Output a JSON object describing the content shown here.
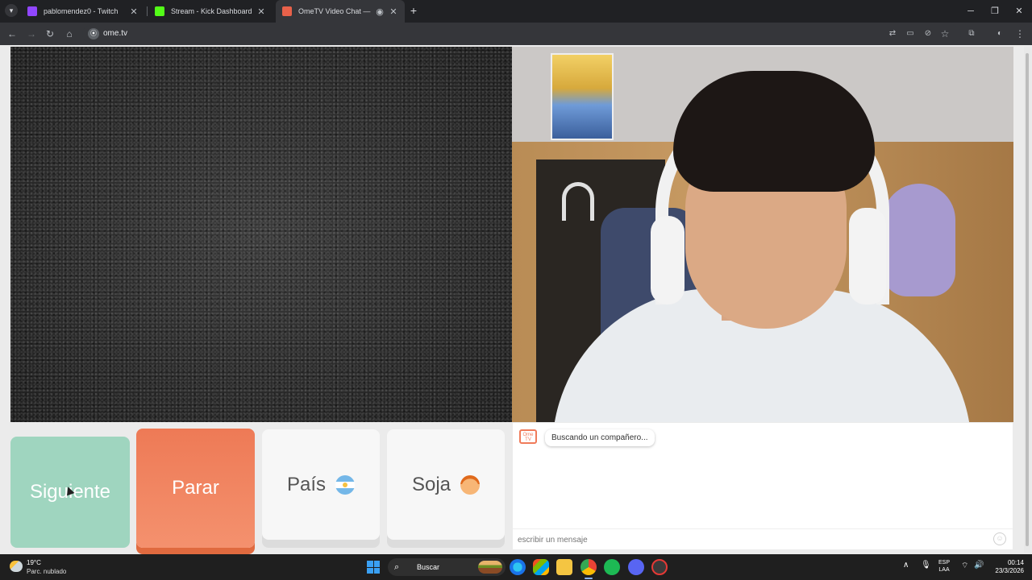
{
  "browser": {
    "tabs": [
      {
        "title": "pablomendez0 - Twitch",
        "favicon_color": "#9146ff"
      },
      {
        "title": "Stream - Kick Dashboard",
        "favicon_color": "#53fc18"
      },
      {
        "title": "OmeTV Video Chat — Alter",
        "favicon_color": "#e8614a",
        "active": true
      }
    ],
    "url": "ome.tv",
    "window_controls": {
      "minimize": "─",
      "restore": "❐",
      "close": "✕"
    }
  },
  "page": {
    "buttons": {
      "next": "Siguiente",
      "stop": "Parar",
      "country": "País",
      "gender": "Soja"
    },
    "chat": {
      "logo_text": "Ome TV",
      "status_message": "Buscando un compañero...",
      "input_placeholder": "escribir un mensaje"
    }
  },
  "taskbar": {
    "weather_temp": "19°C",
    "weather_desc": "Parc. nublado",
    "search_label": "Buscar",
    "lang_line1": "ESP",
    "lang_line2": "LAA",
    "time": "00:14",
    "date": "23/3/2026"
  }
}
